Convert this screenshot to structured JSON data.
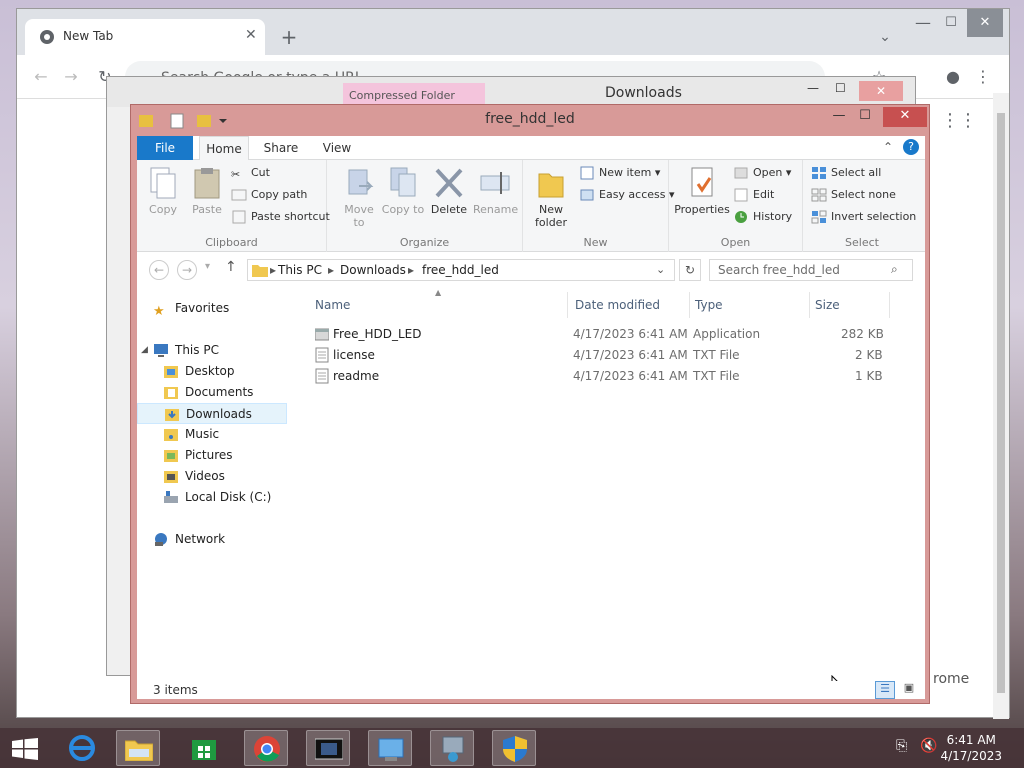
{
  "chrome": {
    "tab_title": "New Tab",
    "omnibox_placeholder": "Search Google or type a URL",
    "fragment": "rome"
  },
  "back_window": {
    "context_tab": "Compressed Folder Tools",
    "title": "Downloads"
  },
  "window": {
    "title": "free_hdd_led",
    "tabs": [
      "File",
      "Home",
      "Share",
      "View"
    ]
  },
  "ribbon": {
    "clipboard": {
      "label": "Clipboard",
      "copy": "Copy",
      "paste": "Paste",
      "cut": "Cut",
      "copy_path": "Copy path",
      "paste_shortcut": "Paste shortcut"
    },
    "organize": {
      "label": "Organize",
      "move_to": "Move to",
      "copy_to": "Copy to",
      "delete": "Delete",
      "rename": "Rename"
    },
    "new": {
      "label": "New",
      "new_folder_1": "New",
      "new_folder_2": "folder",
      "new_item": "New item",
      "easy_access": "Easy access"
    },
    "open": {
      "label": "Open",
      "properties": "Properties",
      "open": "Open",
      "edit": "Edit",
      "history": "History"
    },
    "select": {
      "label": "Select",
      "select_all": "Select all",
      "select_none": "Select none",
      "invert": "Invert selection"
    }
  },
  "address": {
    "crumbs": [
      "This PC",
      "Downloads",
      "free_hdd_led"
    ],
    "search_placeholder": "Search free_hdd_led"
  },
  "nav": {
    "favorites": "Favorites",
    "this_pc": "This PC",
    "items": [
      "Desktop",
      "Documents",
      "Downloads",
      "Music",
      "Pictures",
      "Videos",
      "Local Disk (C:)"
    ],
    "network": "Network"
  },
  "columns": {
    "name": "Name",
    "date": "Date modified",
    "type": "Type",
    "size": "Size"
  },
  "files": [
    {
      "name": "Free_HDD_LED",
      "date": "4/17/2023 6:41 AM",
      "type": "Application",
      "size": "282 KB",
      "icon": "application-icon"
    },
    {
      "name": "license",
      "date": "4/17/2023 6:41 AM",
      "type": "TXT File",
      "size": "2 KB",
      "icon": "text-file-icon"
    },
    {
      "name": "readme",
      "date": "4/17/2023 6:41 AM",
      "type": "TXT File",
      "size": "1 KB",
      "icon": "text-file-icon"
    }
  ],
  "status": {
    "items": "3 items"
  },
  "taskbar": {
    "time": "6:41 AM",
    "date": "4/17/2023"
  },
  "colors": {
    "accent": "#1979ca",
    "window_frame": "#d89a98",
    "close": "#c75050"
  }
}
